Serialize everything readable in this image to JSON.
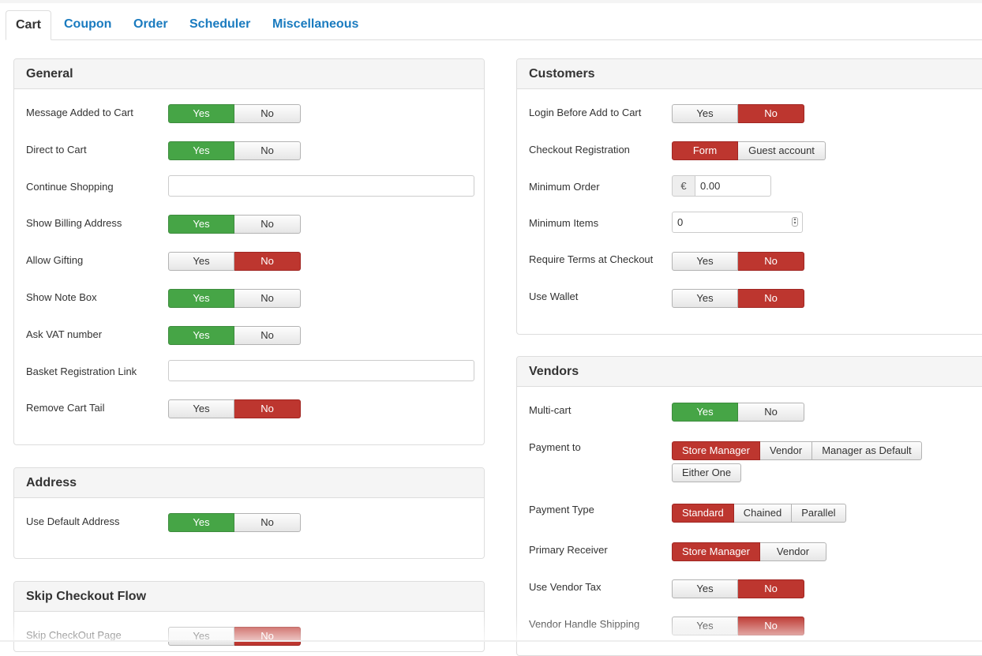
{
  "tabs": [
    "Cart",
    "Coupon",
    "Order",
    "Scheduler",
    "Miscellaneous"
  ],
  "general": {
    "title": "General",
    "message_added": {
      "label": "Message Added to Cart",
      "yes": "Yes",
      "no": "No",
      "selected": "Yes"
    },
    "direct_to_cart": {
      "label": "Direct to Cart",
      "yes": "Yes",
      "no": "No",
      "selected": "Yes"
    },
    "continue_shopping": {
      "label": "Continue Shopping",
      "value": ""
    },
    "show_billing": {
      "label": "Show Billing Address",
      "yes": "Yes",
      "no": "No",
      "selected": "Yes"
    },
    "allow_gifting": {
      "label": "Allow Gifting",
      "yes": "Yes",
      "no": "No",
      "selected": "No"
    },
    "show_note_box": {
      "label": "Show Note Box",
      "yes": "Yes",
      "no": "No",
      "selected": "Yes"
    },
    "ask_vat": {
      "label": "Ask VAT number",
      "yes": "Yes",
      "no": "No",
      "selected": "Yes"
    },
    "basket_reg_link": {
      "label": "Basket Registration Link",
      "value": ""
    },
    "remove_cart_tail": {
      "label": "Remove Cart Tail",
      "yes": "Yes",
      "no": "No",
      "selected": "No"
    }
  },
  "address": {
    "title": "Address",
    "use_default": {
      "label": "Use Default Address",
      "yes": "Yes",
      "no": "No",
      "selected": "Yes"
    }
  },
  "skip_checkout": {
    "title": "Skip Checkout Flow",
    "skip_page": {
      "label": "Skip CheckOut Page",
      "yes": "Yes",
      "no": "No",
      "selected": "No"
    }
  },
  "customers": {
    "title": "Customers",
    "login_before": {
      "label": "Login Before Add to Cart",
      "yes": "Yes",
      "no": "No",
      "selected": "No"
    },
    "checkout_reg": {
      "label": "Checkout Registration",
      "opt1": "Form",
      "opt2": "Guest account",
      "selected": "Form"
    },
    "min_order": {
      "label": "Minimum Order",
      "currency": "€",
      "value": "0.00"
    },
    "min_items": {
      "label": "Minimum Items",
      "value": "0"
    },
    "require_terms": {
      "label": "Require Terms at Checkout",
      "yes": "Yes",
      "no": "No",
      "selected": "No"
    },
    "use_wallet": {
      "label": "Use Wallet",
      "yes": "Yes",
      "no": "No",
      "selected": "No"
    }
  },
  "vendors": {
    "title": "Vendors",
    "multi_cart": {
      "label": "Multi-cart",
      "yes": "Yes",
      "no": "No",
      "selected": "Yes"
    },
    "payment_to": {
      "label": "Payment to",
      "options": [
        "Store Manager",
        "Vendor",
        "Manager as Default",
        "Either One"
      ],
      "selected": "Store Manager"
    },
    "payment_type": {
      "label": "Payment Type",
      "options": [
        "Standard",
        "Chained",
        "Parallel"
      ],
      "selected": "Standard"
    },
    "primary_receiver": {
      "label": "Primary Receiver",
      "options": [
        "Store Manager",
        "Vendor"
      ],
      "selected": "Store Manager"
    },
    "use_vendor_tax": {
      "label": "Use Vendor Tax",
      "yes": "Yes",
      "no": "No",
      "selected": "No"
    },
    "vendor_shipping": {
      "label": "Vendor Handle Shipping",
      "yes": "Yes",
      "no": "No",
      "selected": "No"
    }
  },
  "colors": {
    "on_yes": "#46a546",
    "on_no": "#bd362f",
    "link": "#1a7bbf"
  }
}
